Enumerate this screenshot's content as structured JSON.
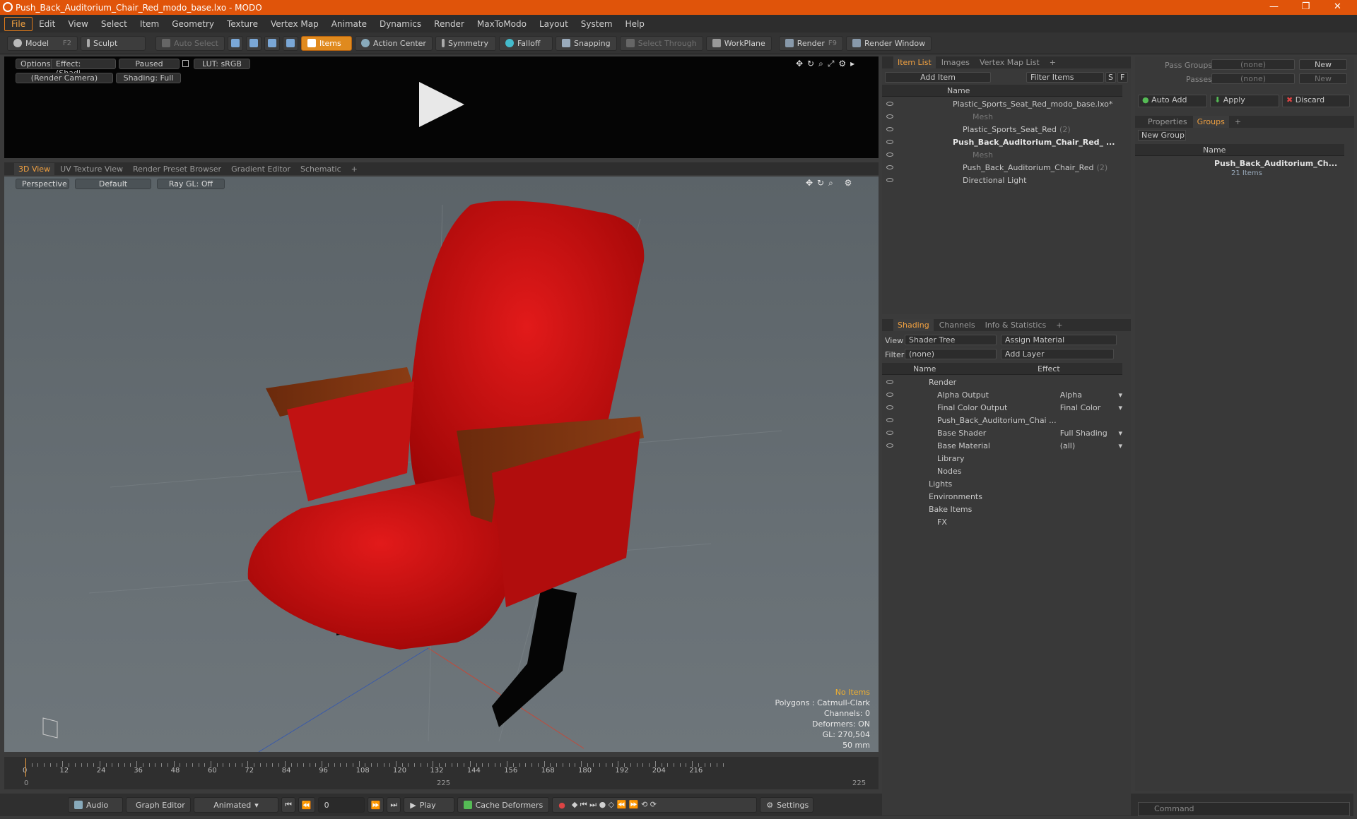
{
  "window": {
    "title": "Push_Back_Auditorium_Chair_Red_modo_base.lxo - MODO",
    "min": "—",
    "max": "❐",
    "close": "✕"
  },
  "menu": [
    "File",
    "Edit",
    "View",
    "Select",
    "Item",
    "Geometry",
    "Texture",
    "Vertex Map",
    "Animate",
    "Dynamics",
    "Render",
    "MaxToModo",
    "Layout",
    "System",
    "Help"
  ],
  "toolbar": {
    "model": "Model",
    "model_key": "F2",
    "sculpt": "Sculpt",
    "auto_select": "Auto Select",
    "items": "Items",
    "action_center": "Action Center",
    "symmetry": "Symmetry",
    "falloff": "Falloff",
    "snapping": "Snapping",
    "select_through": "Select Through",
    "workplane": "WorkPlane",
    "render": "Render",
    "render_key": "F9",
    "render_window": "Render Window"
  },
  "renderview": {
    "options": "Options",
    "effect": "Effect: (Shadi...",
    "paused": "Paused",
    "lut": "LUT: sRGB",
    "camera": "(Render Camera)",
    "shading": "Shading: Full"
  },
  "viewtabs": [
    "3D View",
    "UV Texture View",
    "Render Preset Browser",
    "Gradient Editor",
    "Schematic",
    "+"
  ],
  "viewport": {
    "perspective": "Perspective",
    "default": "Default",
    "raygl": "Ray GL: Off"
  },
  "stats": {
    "no_items": "No Items",
    "polygons": "Polygons : Catmull-Clark",
    "channels": "Channels: 0",
    "deformers": "Deformers: ON",
    "gl": "GL: 270,504",
    "lens": "50 mm"
  },
  "timeline": {
    "ticks": [
      "0",
      "12",
      "24",
      "36",
      "48",
      "60",
      "72",
      "84",
      "96",
      "108",
      "120",
      "132",
      "144",
      "156",
      "168",
      "180",
      "192",
      "204",
      "216"
    ],
    "start": "0",
    "mid": "225",
    "end": "225"
  },
  "bottom": {
    "audio": "Audio",
    "graph_editor": "Graph Editor",
    "animated": "Animated",
    "frame": "0",
    "play": "Play",
    "cache": "Cache Deformers",
    "settings": "Settings",
    "command": "Command"
  },
  "itemlist": {
    "tabs": [
      "Item List",
      "Images",
      "Vertex Map List",
      "+"
    ],
    "add_item": "Add Item",
    "filter": "Filter Items",
    "s": "S",
    "f": "F",
    "name_col": "Name",
    "rows": [
      {
        "t": "Plastic_Sports_Seat_Red_modo_base.lxo*",
        "d": 0,
        "bold": false
      },
      {
        "t": "Mesh",
        "d": 2,
        "gray": true
      },
      {
        "t": "Plastic_Sports_Seat_Red",
        "n": "(2)",
        "d": 1
      },
      {
        "t": "Push_Back_Auditorium_Chair_Red_ ...",
        "d": 0,
        "bold": true
      },
      {
        "t": "Mesh",
        "d": 2,
        "gray": true
      },
      {
        "t": "Push_Back_Auditorium_Chair_Red",
        "n": "(2)",
        "d": 1
      },
      {
        "t": "Directional Light",
        "d": 1
      }
    ]
  },
  "shading": {
    "tabs": [
      "Shading",
      "Channels",
      "Info & Statistics",
      "+"
    ],
    "view_label": "View",
    "view_val": "Shader Tree",
    "assign": "Assign Material",
    "filter_label": "Filter",
    "filter_val": "(none)",
    "add_layer": "Add Layer",
    "col_name": "Name",
    "col_effect": "Effect",
    "rows": [
      {
        "t": "Render",
        "e": ""
      },
      {
        "t": "Alpha Output",
        "e": "Alpha"
      },
      {
        "t": "Final Color Output",
        "e": "Final Color"
      },
      {
        "t": "Push_Back_Auditorium_Chai ...",
        "e": ""
      },
      {
        "t": "Base Shader",
        "e": "Full Shading"
      },
      {
        "t": "Base Material",
        "e": "(all)"
      },
      {
        "t": "Library",
        "e": ""
      },
      {
        "t": "Nodes",
        "e": ""
      },
      {
        "t": "Lights",
        "e": ""
      },
      {
        "t": "Environments",
        "e": ""
      },
      {
        "t": "Bake Items",
        "e": ""
      },
      {
        "t": "FX",
        "e": ""
      }
    ]
  },
  "groups": {
    "pass_groups": "Pass Groups",
    "passes": "Passes",
    "none": "(none)",
    "new": "New",
    "auto_add": "Auto Add",
    "apply": "Apply",
    "discard": "Discard",
    "tabs": [
      "Properties",
      "Groups",
      "+"
    ],
    "new_group": "New Group",
    "col_name": "Name",
    "item": "Push_Back_Auditorium_Ch...",
    "count": "21 Items"
  }
}
